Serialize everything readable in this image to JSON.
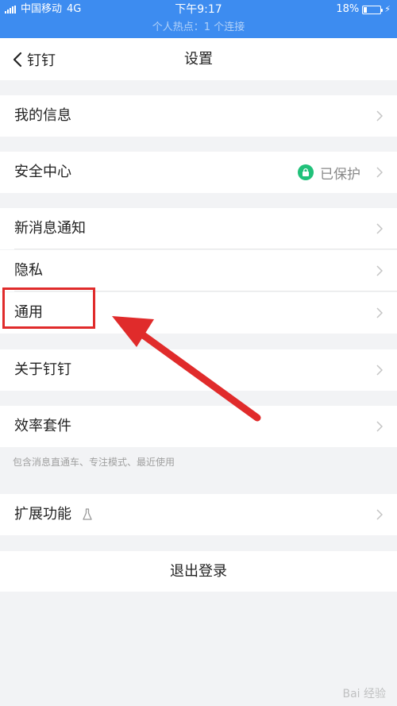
{
  "status_bar": {
    "carrier": "中国移动",
    "network": "4G",
    "time": "下午9:17",
    "hotspot": "个人热点：1 个连接",
    "battery_text": "18%",
    "battery_level": 0.18
  },
  "nav": {
    "back_label": "钉钉",
    "title": "设置"
  },
  "rows": {
    "my_info": "我的信息",
    "security": "安全中心",
    "security_status": "已保护",
    "notifications": "新消息通知",
    "privacy": "隐私",
    "general": "通用",
    "about": "关于钉钉",
    "efficiency": "效率套件",
    "efficiency_note": "包含消息直通车、专注模式、最近使用",
    "extensions": "扩展功能"
  },
  "logout": "退出登录",
  "watermark": "Bai 经验",
  "colors": {
    "status_bar": "#3d8cf0",
    "security_badge": "#21c17a",
    "annotation": "#e02b2b",
    "background": "#f2f3f5"
  }
}
